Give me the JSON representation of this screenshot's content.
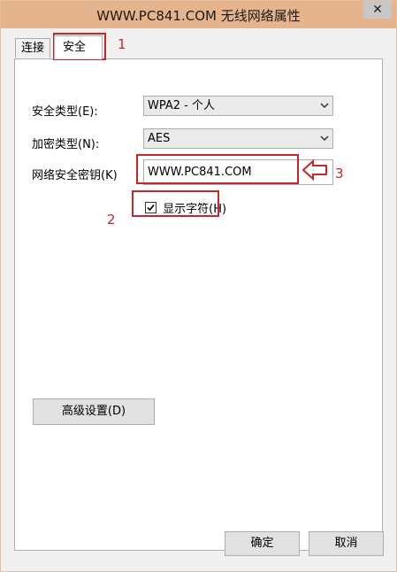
{
  "window": {
    "title": "WWW.PC841.COM 无线网络属性",
    "close_label": "✕"
  },
  "tabs": [
    {
      "label": "连接",
      "selected": false
    },
    {
      "label": "安全",
      "selected": true
    }
  ],
  "security_tab": {
    "security_type_label": "安全类型(E):",
    "security_type_value": "WPA2 - 个人",
    "encryption_type_label": "加密类型(N):",
    "encryption_type_value": "AES",
    "network_key_label": "网络安全密钥(K)",
    "network_key_value": "WWW.PC841.COM",
    "show_characters_label": "显示字符(H)",
    "show_characters_checked": true,
    "advanced_button_label": "高级设置(D)"
  },
  "footer": {
    "ok_label": "确定",
    "cancel_label": "取消"
  },
  "annotations": {
    "marker_1": "1",
    "marker_2": "2",
    "marker_3": "3",
    "color": "#c8252c"
  },
  "icons": {
    "arrow": "left-arrow-icon",
    "chevron": "chevron-down-icon",
    "check": "checkmark-icon"
  }
}
